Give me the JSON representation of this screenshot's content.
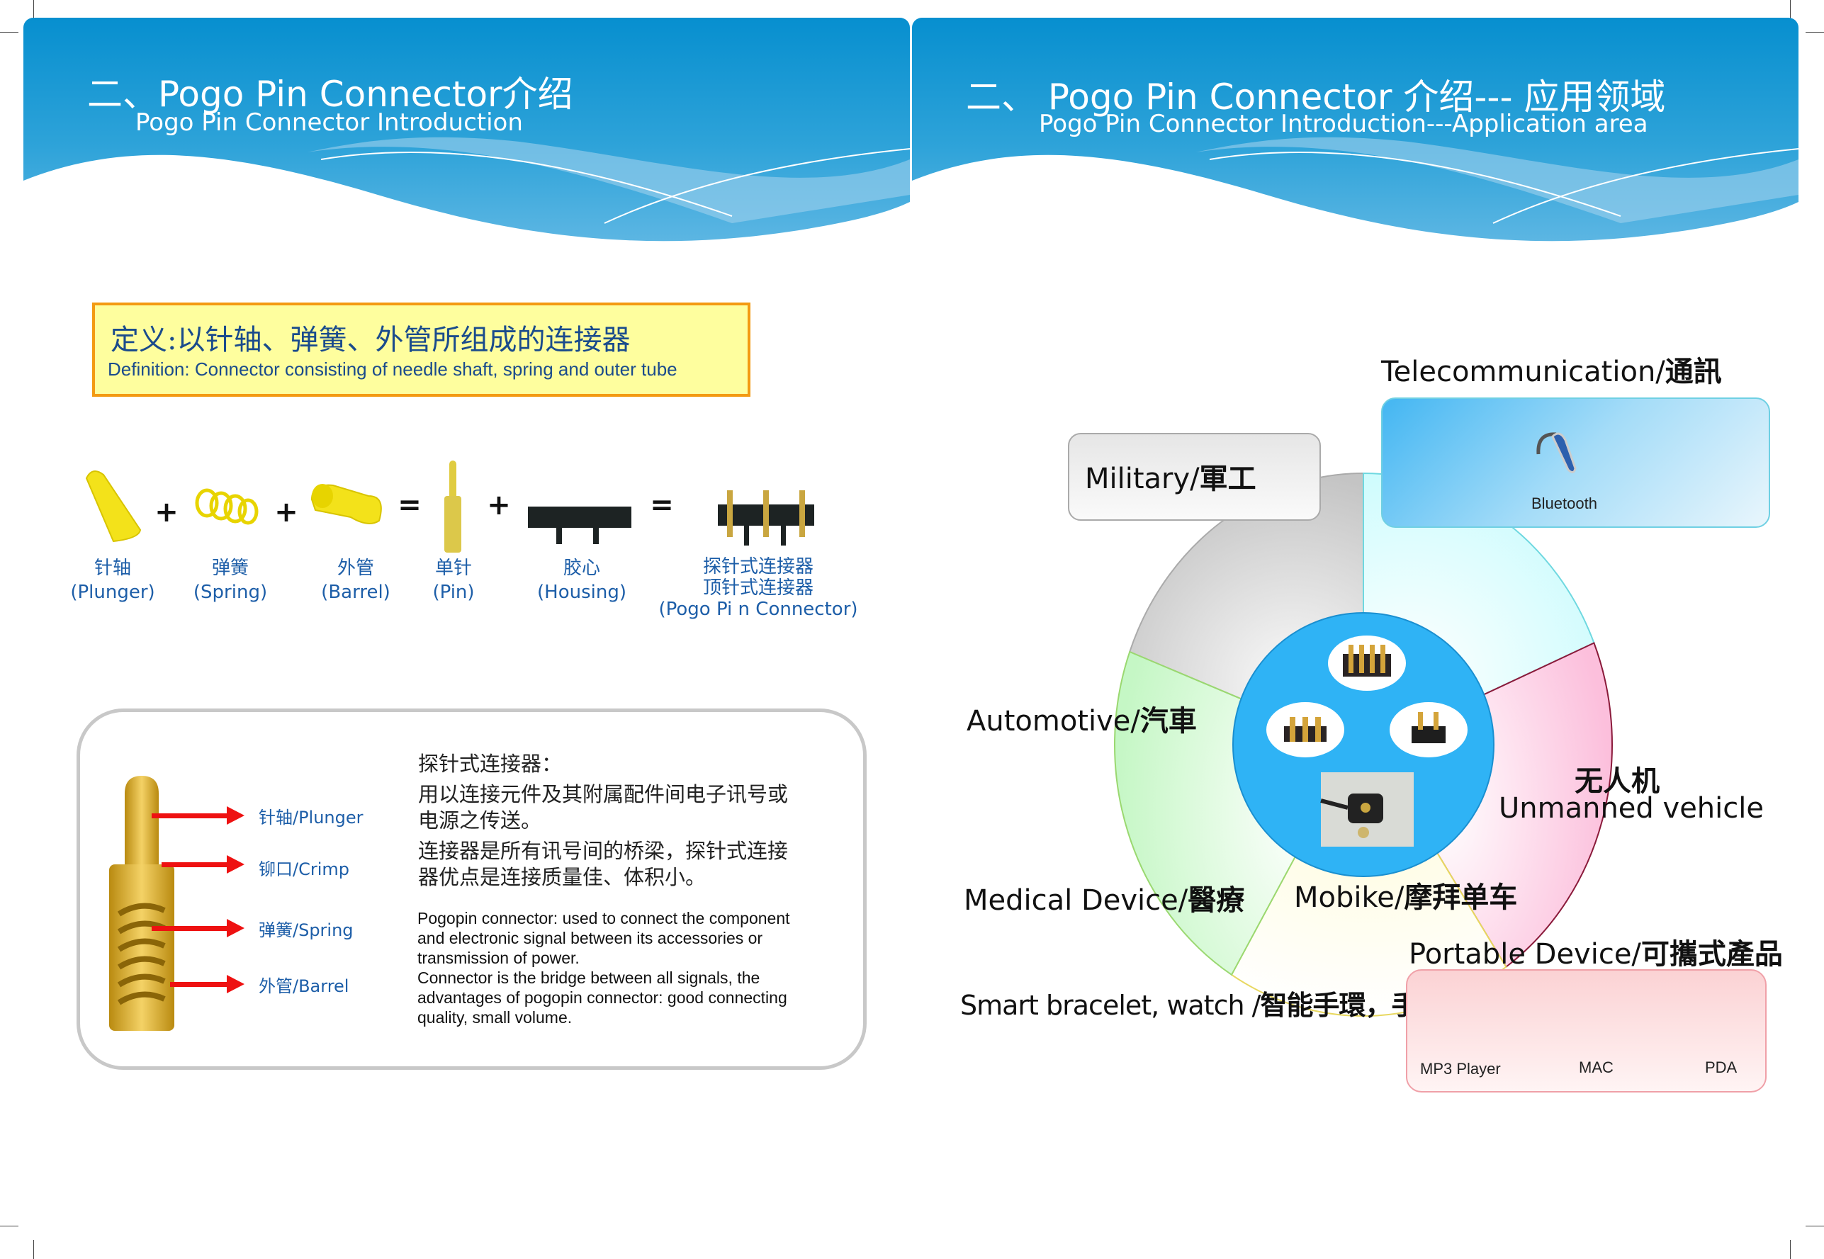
{
  "left_page": {
    "title": "二、Pogo Pin Connector介绍",
    "subtitle": "Pogo Pin Connector Introduction",
    "definition": {
      "cn": "定义:以针轴、弹簧、外管所组成的连接器",
      "en": "Definition: Connector consisting of needle shaft, spring and outer tube"
    },
    "parts": [
      {
        "cn": "针轴",
        "en": "(Plunger)"
      },
      {
        "cn": "弹簧",
        "en": "(Spring)"
      },
      {
        "cn": "外管",
        "en": "(Barrel)"
      },
      {
        "cn": "单针",
        "en": "(Pin)"
      },
      {
        "cn": "胶心",
        "en": "(Housing)"
      },
      {
        "cn": "探针式连接器",
        "cn2": "顶针式连接器",
        "en": "(Pogo Pi n Connector)"
      }
    ],
    "operators": [
      "+",
      "+",
      "=",
      "+",
      "="
    ],
    "pin_labels": [
      "针轴/Plunger",
      "铆口/Crimp",
      "弹簧/Spring",
      "外管/Barrel"
    ],
    "description": {
      "cn_heading": "探针式连接器：",
      "cn_lines": [
        "用以连接元件及其附属配件间电子讯号或",
        "电源之传送。",
        "连接器是所有讯号间的桥梁，探针式连接",
        "器优点是连接质量佳、体积小。"
      ],
      "en_lines": [
        "Pogopin connector: used to connect the component",
        "and electronic signal between its accessories or",
        "transmission of power.",
        "Connector is the bridge between all signals, the",
        "advantages of pogopin connector: good connecting",
        "quality, small volume."
      ]
    }
  },
  "right_page": {
    "title": "二、 Pogo Pin Connector 介绍--- 应用领域",
    "subtitle": "Pogo Pin Connector Introduction---Application area",
    "telecom": {
      "label_en": "Telecommunication/",
      "label_cn": "通訊",
      "item": "Bluetooth"
    },
    "military": {
      "label_en": "Military/",
      "label_cn": "軍工"
    },
    "automotive": {
      "label_en": "Automotive/",
      "label_cn": "汽車"
    },
    "unmanned": {
      "label_cn": "无人机",
      "label_en": "Unmanned vehicle"
    },
    "medical": {
      "label_en": "Medical Device/",
      "label_cn": "醫療"
    },
    "mobike": {
      "label_en": "Mobike/",
      "label_cn": "摩拜单车"
    },
    "portable": {
      "label_en": "Portable Device/",
      "label_cn": "可攜式產品",
      "items": [
        "MP3 Player",
        "MAC",
        "PDA"
      ]
    },
    "smart": {
      "label_en": "Smart bracelet, watch /",
      "label_cn": "智能手環，手表"
    },
    "colors": {
      "center": "#2fb3f5",
      "military": "#cccccc",
      "telecom": "#d5fbfd",
      "unmanned": "#fdc6e0",
      "mobike": "#fffde0",
      "automotive": "#cdf8cd"
    }
  },
  "colors": {
    "header_blue": "#078fcf",
    "definition_border": "#f39a12",
    "definition_fill": "#fefe9e",
    "label_blue": "#1d5ea8",
    "arrow_red": "#ee1111"
  }
}
